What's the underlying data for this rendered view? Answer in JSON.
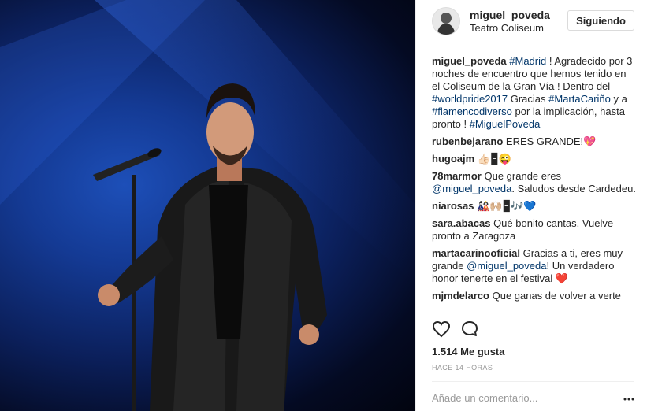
{
  "post": {
    "username": "miguel_poveda",
    "location": "Teatro Coliseum",
    "follow_label": "Siguiendo",
    "caption": {
      "user": "miguel_poveda",
      "parts": [
        {
          "t": "#Madrid",
          "tag": true
        },
        {
          "t": " ! Agradecido por 3 noches de encuentro que hemos tenido en el Coliseum de la Gran Vía ! Dentro del ",
          "tag": false
        },
        {
          "t": "#worldpride2017",
          "tag": true
        },
        {
          "t": " Gracias ",
          "tag": false
        },
        {
          "t": "#MartaCariño",
          "tag": true
        },
        {
          "t": " y a ",
          "tag": false
        },
        {
          "t": "#flamencodiverso",
          "tag": true
        },
        {
          "t": " por la implicación, hasta pronto ! ",
          "tag": false
        },
        {
          "t": "#MiguelPoveda",
          "tag": true
        }
      ]
    },
    "comments": [
      {
        "user": "rubenbejarano",
        "parts": [
          {
            "t": " ERES GRANDE!💖",
            "tag": false
          }
        ]
      },
      {
        "user": "hugoajm",
        "parts": [
          {
            "t": " 👍🏻🁢😜",
            "tag": false
          }
        ]
      },
      {
        "user": "78marmor",
        "parts": [
          {
            "t": " Que grande eres ",
            "tag": false
          },
          {
            "t": "@miguel_poveda",
            "tag": true
          },
          {
            "t": ". Saludos desde Cardedeu.",
            "tag": false
          }
        ]
      },
      {
        "user": "niarosas",
        "parts": [
          {
            "t": " 🎎🙌🏼🁢🎶💙",
            "tag": false
          }
        ]
      },
      {
        "user": "sara.abacas",
        "parts": [
          {
            "t": " Qué bonito cantas. Vuelve pronto a Zaragoza",
            "tag": false
          }
        ]
      },
      {
        "user": "martacarinooficial",
        "parts": [
          {
            "t": " Gracias a ti, eres muy grande ",
            "tag": false
          },
          {
            "t": "@miguel_poveda",
            "tag": true
          },
          {
            "t": "! Un verdadero honor tenerte en el festival ❤️",
            "tag": false
          }
        ]
      },
      {
        "user": "mjmdelarco",
        "parts": [
          {
            "t": " Que ganas de volver a verte",
            "tag": false
          }
        ]
      }
    ],
    "likes_text": "1.514 Me gusta",
    "time_text": "HACE 14 HORAS",
    "comment_placeholder": "Añade un comentario...",
    "icons": {
      "like": "heart-icon",
      "comment": "comment-bubble-icon",
      "more": "more-dots-icon"
    },
    "colors": {
      "tag": "#003569",
      "muted": "#999999",
      "text": "#262626"
    }
  }
}
